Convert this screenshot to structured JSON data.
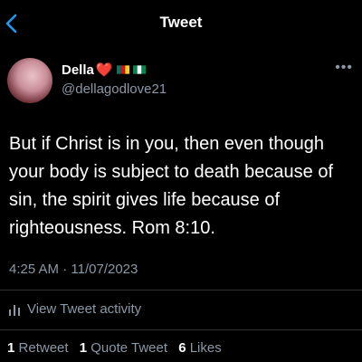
{
  "header": {
    "title": "Tweet",
    "back_icon": "chevron-left-icon"
  },
  "author": {
    "name": "Della",
    "emoji": "❤️",
    "handle": "@dellagodlove21",
    "flags": [
      "cameroon-flag-icon",
      "nigeria-flag-icon"
    ]
  },
  "more_icon": "more-horizontal-icon",
  "tweet": {
    "text": "But if Christ is in you, then even though your body is subject to death because of sin, the spirit gives life because of righteousness. Rom 8:10.",
    "time": "4:25 AM",
    "separator": "·",
    "date": "11/07/2023"
  },
  "activity": {
    "label": "View Tweet activity",
    "icon": "bar-chart-icon"
  },
  "stats": {
    "retweets_count": "1",
    "retweets_label": "Retweet",
    "quotes_count": "1",
    "quotes_label": "Quote Tweet",
    "likes_count": "6",
    "likes_label": "Likes"
  },
  "colors": {
    "accent": "#1d9bf0",
    "background": "#000000",
    "secondary_text": "#8b98a5"
  }
}
